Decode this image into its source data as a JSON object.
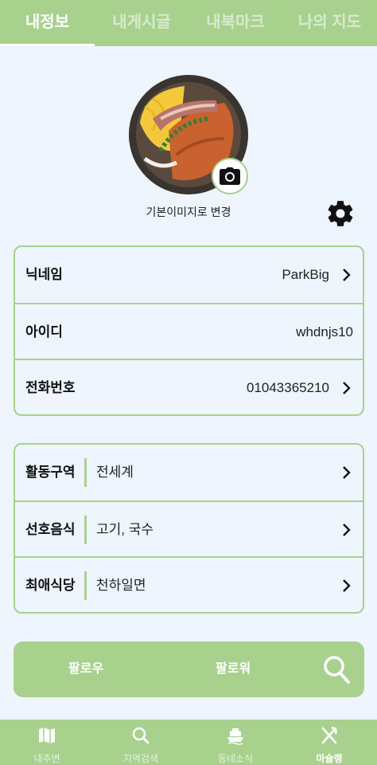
{
  "top_tabs": [
    {
      "label": "내정보",
      "active": true
    },
    {
      "label": "내게시글",
      "active": false
    },
    {
      "label": "내북마크",
      "active": false
    },
    {
      "label": "나의 지도",
      "active": false
    }
  ],
  "profile": {
    "reset_label": "기본이미지로 변경",
    "camera_icon": "camera-icon",
    "settings_icon": "gear-icon"
  },
  "account": {
    "nickname_label": "닉네임",
    "nickname_value": "ParkBig",
    "id_label": "아이디",
    "id_value": "whdnjs10",
    "phone_label": "전화번호",
    "phone_value": "01043365210"
  },
  "preferences": {
    "area_label": "활동구역",
    "area_value": "전세계",
    "food_label": "선호음식",
    "food_value": "고기, 국수",
    "restaurant_label": "최애식당",
    "restaurant_value": "천하일면"
  },
  "follow": {
    "follow_label": "팔로우",
    "follower_label": "팔로워",
    "search_icon": "search-icon"
  },
  "bottom_nav": [
    {
      "label": "내주변",
      "icon": "map-icon",
      "active": false
    },
    {
      "label": "지역검색",
      "icon": "search-icon",
      "active": false
    },
    {
      "label": "동네소식",
      "icon": "boat-icon",
      "active": false
    },
    {
      "label": "마슐랭",
      "icon": "utensils-icon",
      "active": true
    }
  ],
  "colors": {
    "accent": "#a9d18e",
    "background": "#eef5fd"
  }
}
